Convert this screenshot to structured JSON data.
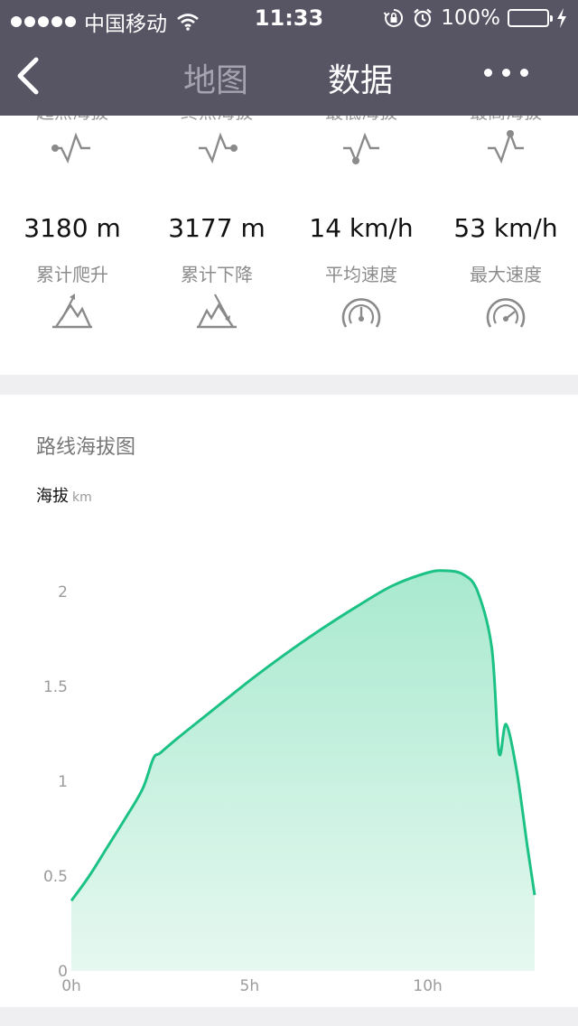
{
  "status_bar": {
    "carrier": "中国移动",
    "time": "11:33",
    "battery": "100%",
    "battery_level": 1.0,
    "icons": [
      "signal-dots",
      "wifi-icon",
      "orientation-lock-icon",
      "alarm-icon",
      "battery-icon",
      "charging-icon"
    ]
  },
  "nav": {
    "back_icon": "chevron-left-icon",
    "tabs": [
      {
        "label": "地图",
        "active": false
      },
      {
        "label": "数据",
        "active": true
      }
    ],
    "more_icon": "more-dots-icon"
  },
  "stats": {
    "top_row": [
      {
        "label": "起点海拔",
        "icon": "elevation-start-icon"
      },
      {
        "label": "终点海拔",
        "icon": "elevation-end-icon"
      },
      {
        "label": "最低海拔",
        "icon": "elevation-min-icon"
      },
      {
        "label": "最高海拔",
        "icon": "elevation-max-icon"
      }
    ],
    "bottom_row": [
      {
        "value": "3180 m",
        "label": "累计爬升",
        "icon": "climb-icon"
      },
      {
        "value": "3177 m",
        "label": "累计下降",
        "icon": "descent-icon"
      },
      {
        "value": "14 km/h",
        "label": "平均速度",
        "icon": "speedometer-avg-icon"
      },
      {
        "value": "53 km/h",
        "label": "最大速度",
        "icon": "speedometer-max-icon"
      }
    ]
  },
  "chart_section": {
    "title": "路线海拔图",
    "axis_name": "海拔",
    "axis_unit": "km"
  },
  "chart_data": {
    "type": "area",
    "title": "路线海拔图",
    "ylabel": "海拔 km",
    "xlabel": "",
    "x_ticks": [
      "0h",
      "5h",
      "10h"
    ],
    "y_ticks": [
      "0",
      "0.5",
      "1",
      "1.5",
      "2"
    ],
    "xlim": [
      0,
      13
    ],
    "ylim": [
      0,
      2
    ],
    "line_color": "#1cc285",
    "fill_color": "#b4ecd6",
    "grid": false,
    "series": [
      {
        "x": [
          0,
          0.5,
          1,
          1.5,
          2,
          2.3,
          2.5,
          3,
          4,
          5,
          6,
          7,
          8,
          9,
          10,
          10.5,
          11,
          11.4,
          11.8,
          12.0,
          12.2,
          12.5,
          12.8,
          13
        ],
        "y": [
          0.37,
          0.5,
          0.65,
          0.8,
          0.96,
          1.12,
          1.15,
          1.23,
          1.38,
          1.53,
          1.67,
          1.8,
          1.92,
          2.03,
          2.1,
          2.11,
          2.09,
          2.0,
          1.7,
          1.15,
          1.3,
          1.05,
          0.65,
          0.4
        ]
      }
    ]
  }
}
